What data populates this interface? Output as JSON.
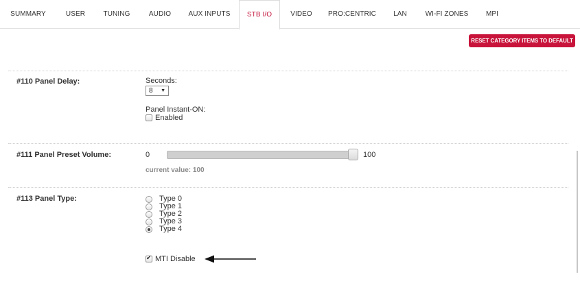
{
  "tabs": [
    {
      "label": "SUMMARY",
      "active": false
    },
    {
      "label": "USER",
      "active": false
    },
    {
      "label": "TUNING",
      "active": false
    },
    {
      "label": "AUDIO",
      "active": false
    },
    {
      "label": "AUX INPUTS",
      "active": false
    },
    {
      "label": "STB I/O",
      "active": true
    },
    {
      "label": "VIDEO",
      "active": false
    },
    {
      "label": "PRO:CENTRIC",
      "active": false
    },
    {
      "label": "LAN",
      "active": false
    },
    {
      "label": "WI-FI ZONES",
      "active": false
    },
    {
      "label": "MPI",
      "active": false
    }
  ],
  "reset_button": "RESET CATEGORY ITEMS TO DEFAULT",
  "panel_delay": {
    "label": "#110 Panel Delay:",
    "seconds_label": "Seconds:",
    "seconds_value": "8",
    "instant_on_label": "Panel Instant-ON:",
    "enabled_label": "Enabled",
    "enabled_checked": false
  },
  "preset_volume": {
    "label": "#111 Panel Preset Volume:",
    "min": "0",
    "max": "100",
    "value": 100,
    "current_value_text": "current value: 100"
  },
  "panel_type": {
    "label": "#113 Panel Type:",
    "options": [
      "Type 0",
      "Type 1",
      "Type 2",
      "Type 3",
      "Type 4"
    ],
    "selected": "Type 4",
    "mti_label": "MTI Disable",
    "mti_checked": true
  },
  "colors": {
    "accent": "#c8143b",
    "active_tab_text": "#c4173e"
  },
  "icons": {
    "annotation": "arrow-left-icon",
    "dropdown": "caret-down-icon"
  }
}
